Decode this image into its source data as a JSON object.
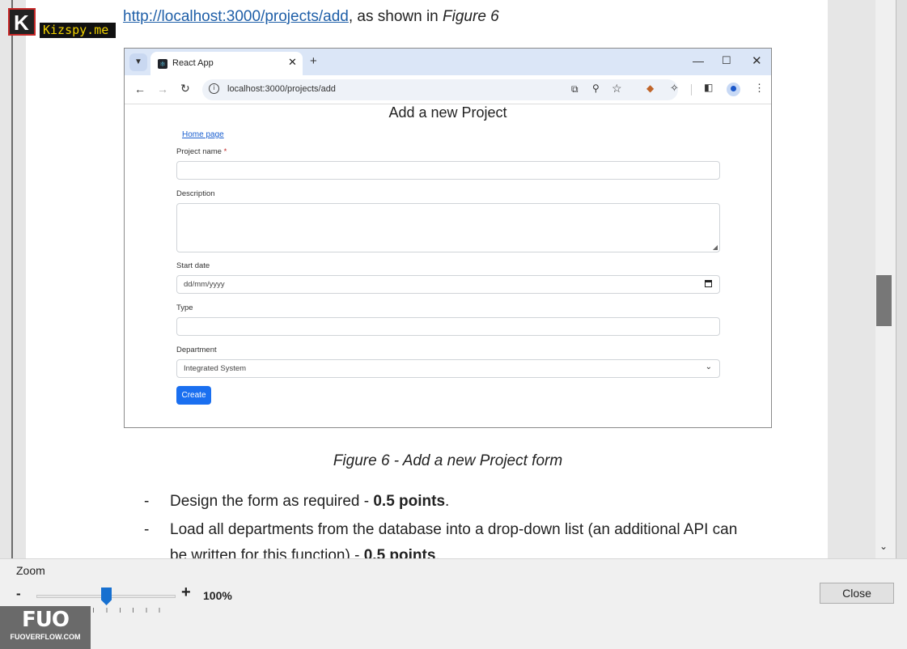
{
  "branding": {
    "kizspy_label": "Kizspy.me",
    "fuo_mark": "FUO",
    "fuo_site": "FUOVERFLOW.COM"
  },
  "document": {
    "intro_link": "http://localhost:3000/projects/add",
    "intro_text": ", as shown in ",
    "intro_figure": "Figure 6",
    "caption": "Figure 6 - Add a new Project form",
    "bullets": [
      {
        "dash": "-",
        "text": "Design the form as required - ",
        "bold": "0.5 points",
        "tail": "."
      },
      {
        "dash": "-",
        "text": "Load all departments from the database into a drop-down list (an additional API can",
        "bold": "",
        "tail": ""
      },
      {
        "dash": "",
        "text": "be written for this function) - ",
        "bold": "0.5 points",
        "tail": "."
      }
    ]
  },
  "browser": {
    "tab_title": "React App",
    "tab_close": "✕",
    "new_tab": "+",
    "url": "localhost:3000/projects/add",
    "window_controls": {
      "minimize": "—",
      "maximize": "☐",
      "close": "✕"
    },
    "icons": [
      "tab-search-icon",
      "react-icon",
      "back-arrow-icon",
      "forward-arrow-icon",
      "reload-icon",
      "site-info-icon",
      "cast-icon",
      "zoom-icon",
      "star-icon",
      "extension-icon",
      "puzzle-icon",
      "side-panel-icon",
      "profile-icon",
      "menu-icon"
    ]
  },
  "form": {
    "title": "Add a new Project",
    "home_link": "Home page",
    "project_name_label": "Project name",
    "required_mark": "*",
    "description_label": "Description",
    "start_date_label": "Start date",
    "start_date_placeholder": "dd/mm/yyyy",
    "type_label": "Type",
    "department_label": "Department",
    "department_selected": "Integrated System",
    "create_button": "Create",
    "button_color": "#1a6ff0"
  },
  "viewer": {
    "zoom_label": "Zoom",
    "zoom_minus": "-",
    "zoom_plus": "+",
    "zoom_value": "100%",
    "zoom_level": 0.5,
    "close_label": "Close"
  }
}
